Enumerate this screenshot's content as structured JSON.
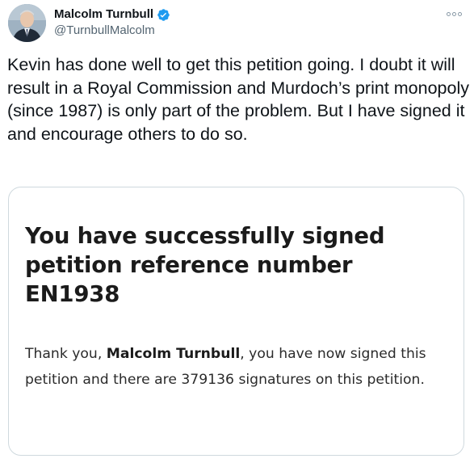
{
  "tweet": {
    "author": {
      "display_name": "Malcolm Turnbull",
      "handle": "@TurnbullMalcolm",
      "verified": true,
      "avatar_icon": "profile-photo"
    },
    "more_icon": "more-options-icon",
    "text": "Kevin has done well to get this petition going. I doubt it will result in a Royal Commission and Murdoch’s print monopoly (since 1987) is only part of the problem. But I have signed it and encourage others to do so."
  },
  "petition_card": {
    "heading": "You have successfully signed petition reference number EN1938",
    "body_prefix": "Thank you, ",
    "signer_name": "Malcolm Turnbull",
    "body_suffix": ", you have now signed this petition and there are 379136 signatures on this petition."
  },
  "colors": {
    "text_primary": "#0f1419",
    "text_secondary": "#536471",
    "verified_badge": "#1d9bf0",
    "card_border": "#cfd9de"
  }
}
